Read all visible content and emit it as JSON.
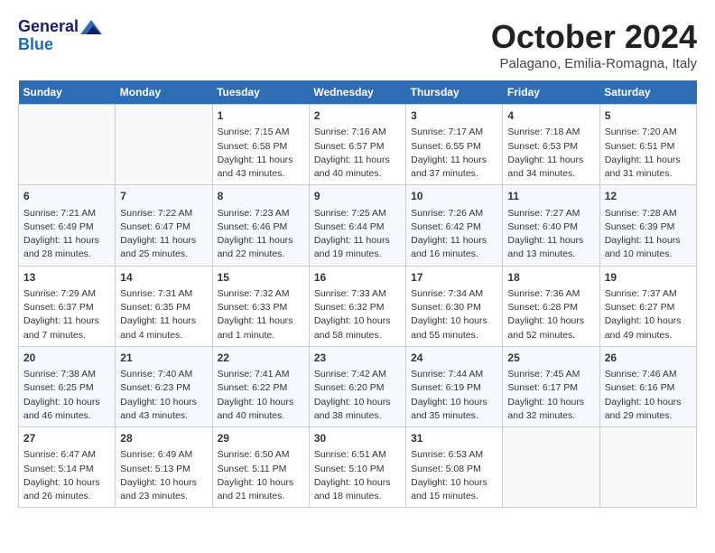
{
  "header": {
    "logo_general": "General",
    "logo_blue": "Blue",
    "month_title": "October 2024",
    "location": "Palagano, Emilia-Romagna, Italy"
  },
  "days_of_week": [
    "Sunday",
    "Monday",
    "Tuesday",
    "Wednesday",
    "Thursday",
    "Friday",
    "Saturday"
  ],
  "weeks": [
    [
      {
        "day": "",
        "info": ""
      },
      {
        "day": "",
        "info": ""
      },
      {
        "day": "1",
        "info": "Sunrise: 7:15 AM\nSunset: 6:58 PM\nDaylight: 11 hours\nand 43 minutes."
      },
      {
        "day": "2",
        "info": "Sunrise: 7:16 AM\nSunset: 6:57 PM\nDaylight: 11 hours\nand 40 minutes."
      },
      {
        "day": "3",
        "info": "Sunrise: 7:17 AM\nSunset: 6:55 PM\nDaylight: 11 hours\nand 37 minutes."
      },
      {
        "day": "4",
        "info": "Sunrise: 7:18 AM\nSunset: 6:53 PM\nDaylight: 11 hours\nand 34 minutes."
      },
      {
        "day": "5",
        "info": "Sunrise: 7:20 AM\nSunset: 6:51 PM\nDaylight: 11 hours\nand 31 minutes."
      }
    ],
    [
      {
        "day": "6",
        "info": "Sunrise: 7:21 AM\nSunset: 6:49 PM\nDaylight: 11 hours\nand 28 minutes."
      },
      {
        "day": "7",
        "info": "Sunrise: 7:22 AM\nSunset: 6:47 PM\nDaylight: 11 hours\nand 25 minutes."
      },
      {
        "day": "8",
        "info": "Sunrise: 7:23 AM\nSunset: 6:46 PM\nDaylight: 11 hours\nand 22 minutes."
      },
      {
        "day": "9",
        "info": "Sunrise: 7:25 AM\nSunset: 6:44 PM\nDaylight: 11 hours\nand 19 minutes."
      },
      {
        "day": "10",
        "info": "Sunrise: 7:26 AM\nSunset: 6:42 PM\nDaylight: 11 hours\nand 16 minutes."
      },
      {
        "day": "11",
        "info": "Sunrise: 7:27 AM\nSunset: 6:40 PM\nDaylight: 11 hours\nand 13 minutes."
      },
      {
        "day": "12",
        "info": "Sunrise: 7:28 AM\nSunset: 6:39 PM\nDaylight: 11 hours\nand 10 minutes."
      }
    ],
    [
      {
        "day": "13",
        "info": "Sunrise: 7:29 AM\nSunset: 6:37 PM\nDaylight: 11 hours\nand 7 minutes."
      },
      {
        "day": "14",
        "info": "Sunrise: 7:31 AM\nSunset: 6:35 PM\nDaylight: 11 hours\nand 4 minutes."
      },
      {
        "day": "15",
        "info": "Sunrise: 7:32 AM\nSunset: 6:33 PM\nDaylight: 11 hours\nand 1 minute."
      },
      {
        "day": "16",
        "info": "Sunrise: 7:33 AM\nSunset: 6:32 PM\nDaylight: 10 hours\nand 58 minutes."
      },
      {
        "day": "17",
        "info": "Sunrise: 7:34 AM\nSunset: 6:30 PM\nDaylight: 10 hours\nand 55 minutes."
      },
      {
        "day": "18",
        "info": "Sunrise: 7:36 AM\nSunset: 6:28 PM\nDaylight: 10 hours\nand 52 minutes."
      },
      {
        "day": "19",
        "info": "Sunrise: 7:37 AM\nSunset: 6:27 PM\nDaylight: 10 hours\nand 49 minutes."
      }
    ],
    [
      {
        "day": "20",
        "info": "Sunrise: 7:38 AM\nSunset: 6:25 PM\nDaylight: 10 hours\nand 46 minutes."
      },
      {
        "day": "21",
        "info": "Sunrise: 7:40 AM\nSunset: 6:23 PM\nDaylight: 10 hours\nand 43 minutes."
      },
      {
        "day": "22",
        "info": "Sunrise: 7:41 AM\nSunset: 6:22 PM\nDaylight: 10 hours\nand 40 minutes."
      },
      {
        "day": "23",
        "info": "Sunrise: 7:42 AM\nSunset: 6:20 PM\nDaylight: 10 hours\nand 38 minutes."
      },
      {
        "day": "24",
        "info": "Sunrise: 7:44 AM\nSunset: 6:19 PM\nDaylight: 10 hours\nand 35 minutes."
      },
      {
        "day": "25",
        "info": "Sunrise: 7:45 AM\nSunset: 6:17 PM\nDaylight: 10 hours\nand 32 minutes."
      },
      {
        "day": "26",
        "info": "Sunrise: 7:46 AM\nSunset: 6:16 PM\nDaylight: 10 hours\nand 29 minutes."
      }
    ],
    [
      {
        "day": "27",
        "info": "Sunrise: 6:47 AM\nSunset: 5:14 PM\nDaylight: 10 hours\nand 26 minutes."
      },
      {
        "day": "28",
        "info": "Sunrise: 6:49 AM\nSunset: 5:13 PM\nDaylight: 10 hours\nand 23 minutes."
      },
      {
        "day": "29",
        "info": "Sunrise: 6:50 AM\nSunset: 5:11 PM\nDaylight: 10 hours\nand 21 minutes."
      },
      {
        "day": "30",
        "info": "Sunrise: 6:51 AM\nSunset: 5:10 PM\nDaylight: 10 hours\nand 18 minutes."
      },
      {
        "day": "31",
        "info": "Sunrise: 6:53 AM\nSunset: 5:08 PM\nDaylight: 10 hours\nand 15 minutes."
      },
      {
        "day": "",
        "info": ""
      },
      {
        "day": "",
        "info": ""
      }
    ]
  ]
}
